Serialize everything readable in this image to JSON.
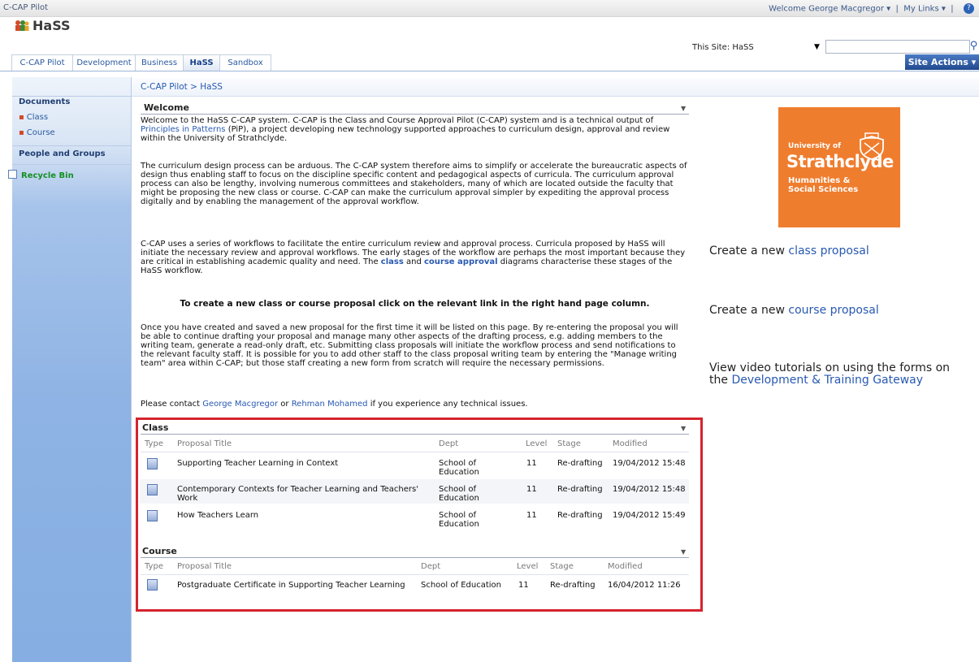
{
  "topbar": {
    "site_name": "C-CAP Pilot",
    "welcome": "Welcome George Macgregor",
    "my_links": "My Links",
    "help_glyph": "?"
  },
  "header": {
    "title": "HaSS",
    "search_scope": "This Site: HaSS",
    "search_placeholder": ""
  },
  "tabs": [
    {
      "label": "C-CAP Pilot"
    },
    {
      "label": "Development"
    },
    {
      "label": "Business"
    },
    {
      "label": "HaSS"
    },
    {
      "label": "Sandbox"
    }
  ],
  "site_actions": "Site Actions",
  "sidebar": {
    "documents": "Documents",
    "class": "Class",
    "course": "Course",
    "people": "People and Groups",
    "recycle": "Recycle Bin"
  },
  "breadcrumb": "C-CAP Pilot > HaSS",
  "welcome": {
    "title": "Welcome",
    "p1_a": "Welcome to the HaSS C-CAP system.  C-CAP is the Class and Course Approval Pilot (C-CAP) system and is a technical output of ",
    "p1_link": "Principles in Patterns",
    "p1_b": " (PiP), a project developing new technology supported approaches to curriculum design, approval and review within the University of Strathclyde.",
    "p2": "The curriculum design process can be arduous.  The C-CAP system therefore aims to simplify or accelerate the bureaucratic aspects of design thus enabling staff to focus on the discipline specific content and pedagogical aspects of curricula.  The curriculum approval process can also be lengthy, involving numerous committees and stakeholders, many of which are located outside the faculty that might be proposing the new class or course.  C-CAP can make the curriculum approval simpler by expediting the approval process digitally and by enabling the management of the approval workflow.",
    "p3_a": "C-CAP uses a series of workflows to facilitate the entire curriculum review and approval process.  Curricula proposed by HaSS will initiate the necessary review and approval workflows.  The early stages of the workflow are perhaps the most important because they are critical in establishing academic quality and need.  The ",
    "p3_link1": "class",
    "p3_mid": " and ",
    "p3_link2": "course approval",
    "p3_b": " diagrams characterise these stages of the HaSS workflow.",
    "strong": "To create a new class or course proposal click on the relevant link in the right hand page column.",
    "p4": "Once you have created and saved a new proposal for the first time it will be listed on this page.  By re-entering the proposal you will be able to continue drafting your proposal and manage many other aspects of the drafting process, e.g. adding members to the writing team, generate a read-only draft, etc.  Submitting class proposals will initiate the workflow process and send notifications to the relevant faculty staff.  It is possible for you to add other staff to the class proposal writing team by entering the \"Manage writing team\" area within C-CAP; but those staff creating a new form from scratch will require the necessary permissions.",
    "p5_a": "Please contact ",
    "p5_link1": "George Macgregor",
    "p5_mid": " or ",
    "p5_link2": "Rehman Mohamed",
    "p5_b": " if you experience any technical issues."
  },
  "class_list": {
    "title": "Class",
    "cols": [
      "Type",
      "Proposal Title",
      "Dept",
      "Level",
      "Stage",
      "Modified"
    ],
    "rows": [
      {
        "title": "Supporting Teacher Learning in Context",
        "dept": "School of Education",
        "level": "11",
        "stage": "Re-drafting",
        "modified": "19/04/2012 15:48"
      },
      {
        "title": "Contemporary Contexts for Teacher Learning and Teachers' Work",
        "dept": "School of Education",
        "level": "11",
        "stage": "Re-drafting",
        "modified": "19/04/2012 15:48"
      },
      {
        "title": "How Teachers Learn",
        "dept": "School of Education",
        "level": "11",
        "stage": "Re-drafting",
        "modified": "19/04/2012 15:49"
      }
    ]
  },
  "course_list": {
    "title": "Course",
    "cols": [
      "Type",
      "Proposal Title",
      "Dept",
      "Level",
      "Stage",
      "Modified"
    ],
    "rows": [
      {
        "title": "Postgraduate Certificate in Supporting Teacher Learning",
        "dept": "School of Education",
        "level": "11",
        "stage": "Re-drafting",
        "modified": "16/04/2012 11:26"
      }
    ]
  },
  "right": {
    "logo_l1": "University of",
    "logo_l2": "Strathclyde",
    "logo_l3a": "Humanities &",
    "logo_l3b": "Social Sciences",
    "class_a": "Create a new ",
    "class_link": "class proposal",
    "course_a": "Create a new ",
    "course_link": "course proposal",
    "video_a": "View video tutorials on using the forms on the ",
    "video_link": "Development & Training Gateway"
  }
}
